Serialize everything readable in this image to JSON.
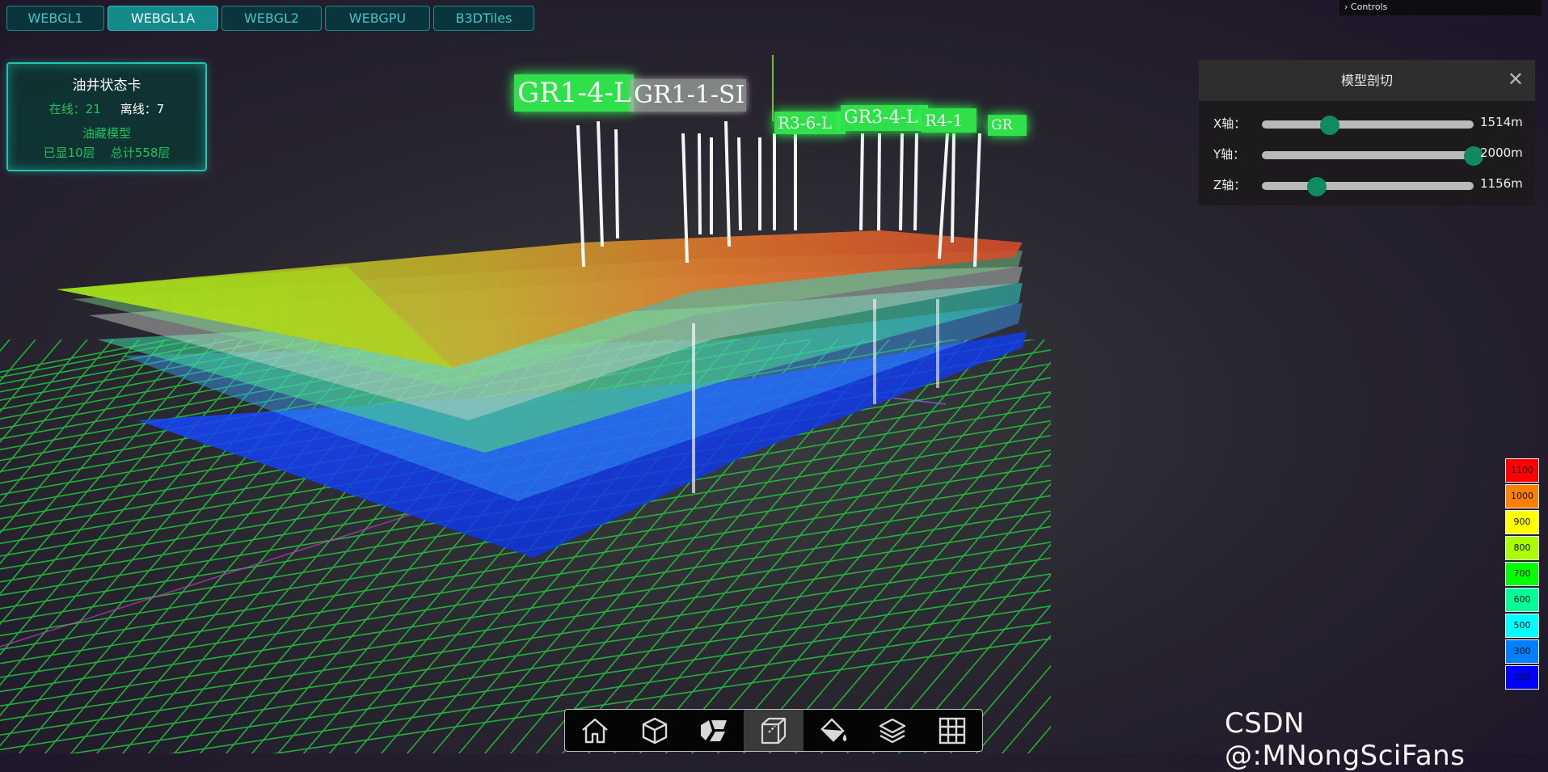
{
  "tabs": [
    {
      "label": "WEBGL1",
      "active": false
    },
    {
      "label": "WEBGL1A",
      "active": true
    },
    {
      "label": "WEBGL2",
      "active": false
    },
    {
      "label": "WEBGPU",
      "active": false
    },
    {
      "label": "B3DTiles",
      "active": false
    }
  ],
  "controls_label": "Controls",
  "status_card": {
    "title": "油井状态卡",
    "online_label": "在线：21",
    "offline_label": "离线：7",
    "model_label": "油藏模型",
    "shown_layers": "已显10层",
    "total_layers": "总计558层"
  },
  "clip_panel": {
    "title": "模型剖切",
    "close_icon": "close-icon",
    "sliders": [
      {
        "label": "X轴：",
        "value": "1514m",
        "fraction": 0.32
      },
      {
        "label": "Y轴：",
        "value": "2000m",
        "fraction": 1.0
      },
      {
        "label": "Z轴：",
        "value": "1156m",
        "fraction": 0.26
      }
    ]
  },
  "legend": [
    {
      "label": "1100",
      "color": "#ff0000"
    },
    {
      "label": "1000",
      "color": "#ff8000"
    },
    {
      "label": "900",
      "color": "#ffff00"
    },
    {
      "label": "800",
      "color": "#aaff00"
    },
    {
      "label": "700",
      "color": "#00ff00"
    },
    {
      "label": "600",
      "color": "#00ff99"
    },
    {
      "label": "500",
      "color": "#00ffff"
    },
    {
      "label": "300",
      "color": "#0080ff"
    },
    {
      "label": "100",
      "color": "#0000ff"
    }
  ],
  "well_labels": [
    "GR1-4-L",
    "GR1-1-SI",
    "R3-6-L",
    "GR3-4-L",
    "R4-1",
    "GR"
  ],
  "toolbar": [
    {
      "icon": "home-icon"
    },
    {
      "icon": "cube-icon"
    },
    {
      "icon": "cube-split-icon"
    },
    {
      "icon": "section-cube-icon"
    },
    {
      "icon": "paint-bucket-icon"
    },
    {
      "icon": "layers-icon"
    },
    {
      "icon": "grid-icon"
    }
  ],
  "toolbar_active_index": 3,
  "watermark": "CSDN @:MNongSciFans"
}
